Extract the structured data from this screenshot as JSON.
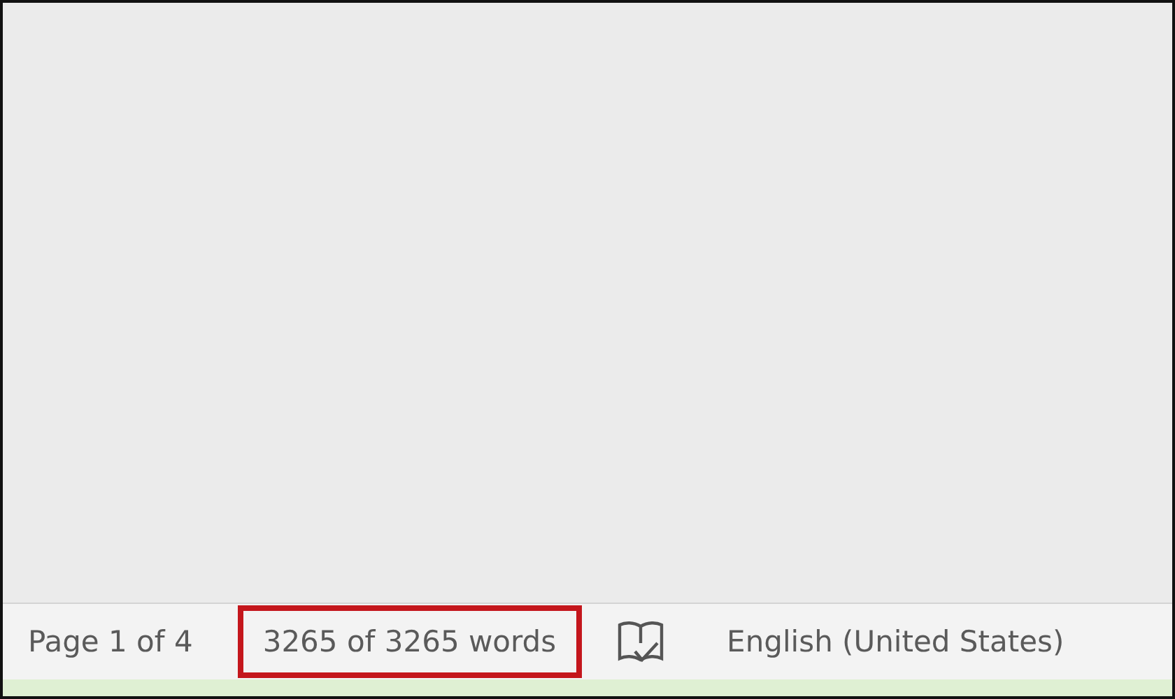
{
  "status_bar": {
    "page": "Page 1 of 4",
    "word_count": {
      "text": "3265 of 3265 words",
      "highlighted": true
    },
    "language": "English (United States)"
  }
}
